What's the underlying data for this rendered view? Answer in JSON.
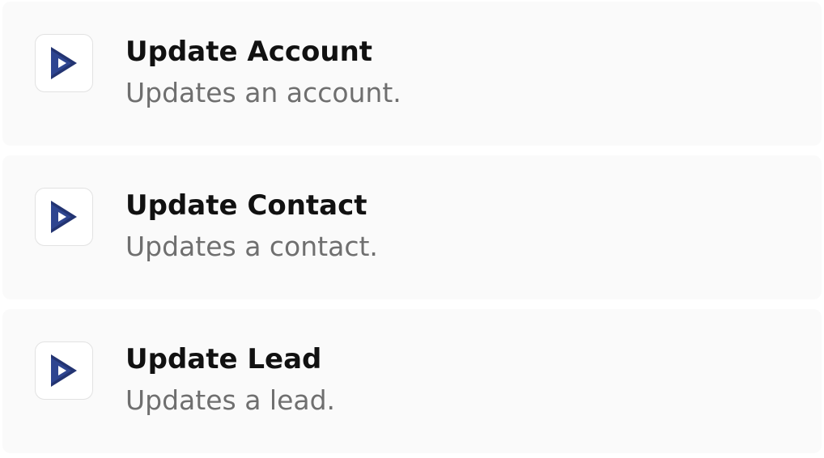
{
  "icon_name": "dynamics-logo-icon",
  "brand_color": "#233472",
  "actions": [
    {
      "title": "Update Account",
      "description": "Updates an account."
    },
    {
      "title": "Update Contact",
      "description": "Updates a contact."
    },
    {
      "title": "Update Lead",
      "description": "Updates a lead."
    }
  ]
}
